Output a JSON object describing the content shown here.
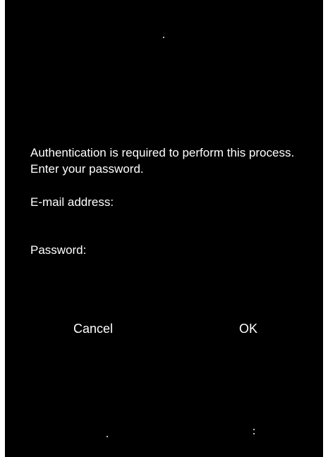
{
  "dialog": {
    "message": "Authentication is required to perform this process. Enter your password.",
    "email_label": "E-mail address:",
    "email_value": "",
    "password_label": "Password:",
    "password_value": "",
    "cancel_label": "Cancel",
    "ok_label": "OK"
  },
  "colors": {
    "background": "#000000",
    "text": "#ffffff"
  }
}
